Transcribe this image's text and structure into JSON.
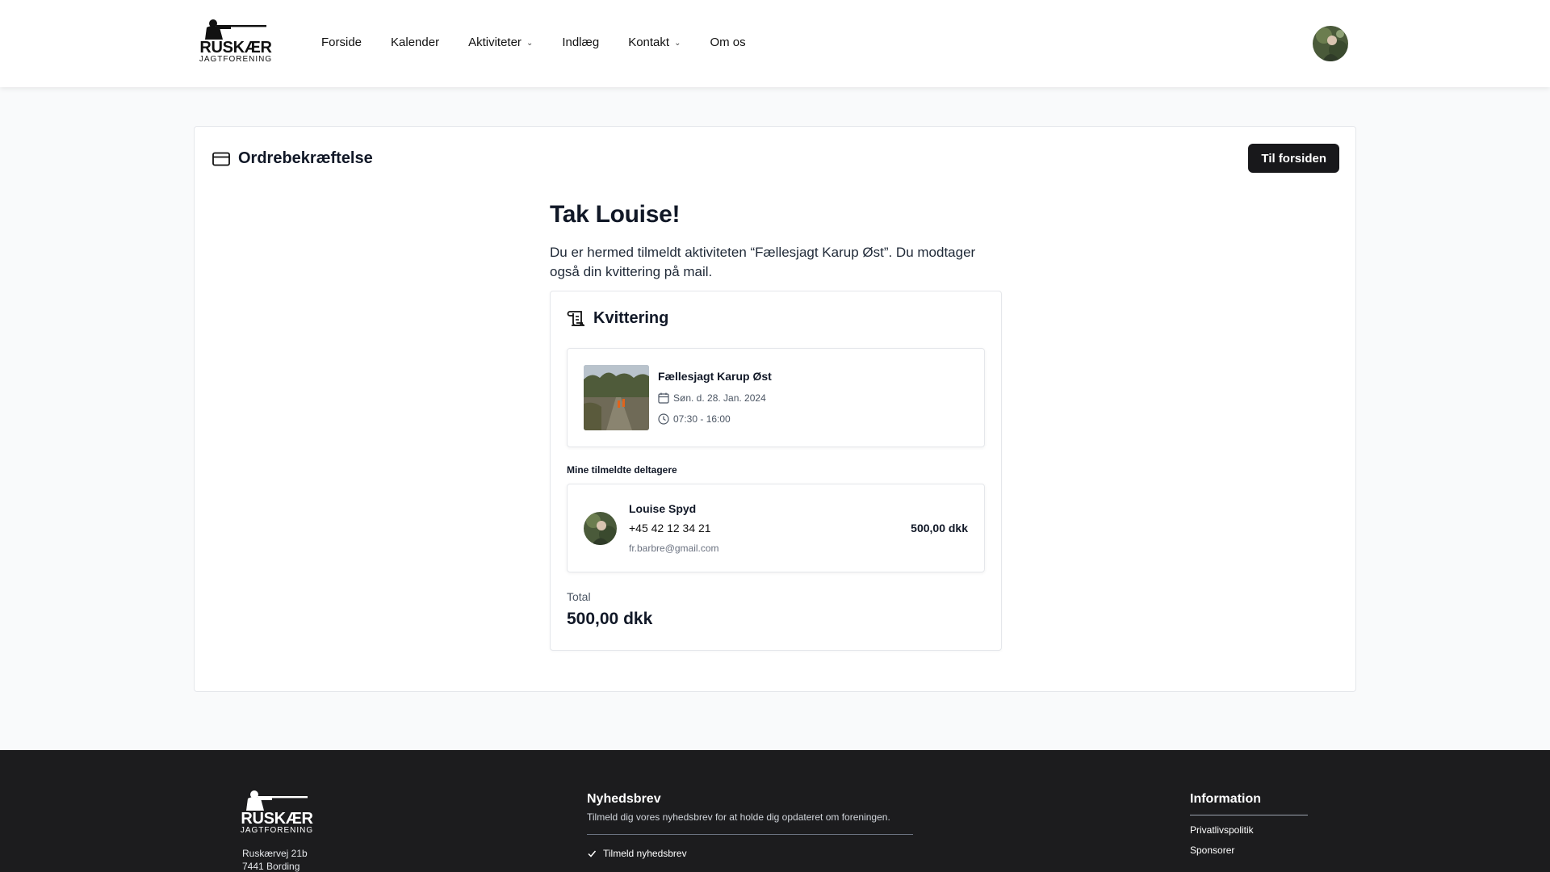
{
  "brand": {
    "name": "RUSKÆR",
    "sub": "JAGTFORENING"
  },
  "nav": {
    "items": [
      {
        "label": "Forside",
        "dropdown": false
      },
      {
        "label": "Kalender",
        "dropdown": false
      },
      {
        "label": "Aktiviteter",
        "dropdown": true
      },
      {
        "label": "Indlæg",
        "dropdown": false
      },
      {
        "label": "Kontakt",
        "dropdown": true
      },
      {
        "label": "Om os",
        "dropdown": false
      }
    ]
  },
  "page": {
    "title": "Ordrebekræftelse",
    "home_button": "Til forsiden",
    "thanks_heading": "Tak Louise!",
    "thanks_text": "Du er hermed tilmeldt aktiviteten “Fællesjagt Karup Øst”. Du modtager også din kvittering på mail."
  },
  "receipt": {
    "title": "Kvittering",
    "event": {
      "name": "Fællesjagt Karup Øst",
      "date": "Søn. d. 28. Jan. 2024",
      "time": "07:30 - 16:00"
    },
    "participants_label": "Mine tilmeldte deltagere",
    "participant": {
      "name": "Louise Spyd",
      "phone": "+45 42 12 34 21",
      "email": "fr.barbre@gmail.com",
      "price": "500,00 dkk"
    },
    "total_label": "Total",
    "total_value": "500,00 dkk"
  },
  "footer": {
    "address_line1": "Ruskærvej 21b",
    "address_line2": "7441 Bording",
    "newsletter": {
      "title": "Nyhedsbrev",
      "text": "Tilmeld dig vores nyhedsbrev for at holde dig opdateret om foreningen.",
      "subscribe_label": "Tilmeld nyhedsbrev"
    },
    "info": {
      "title": "Information",
      "links": [
        "Privatlivspolitik",
        "Sponsorer"
      ]
    }
  },
  "icons": {
    "card": "credit-card-icon",
    "receipt": "scroll-icon",
    "calendar": "calendar-icon",
    "clock": "clock-icon",
    "check": "check-icon",
    "chevron": "chevron-down-icon"
  }
}
